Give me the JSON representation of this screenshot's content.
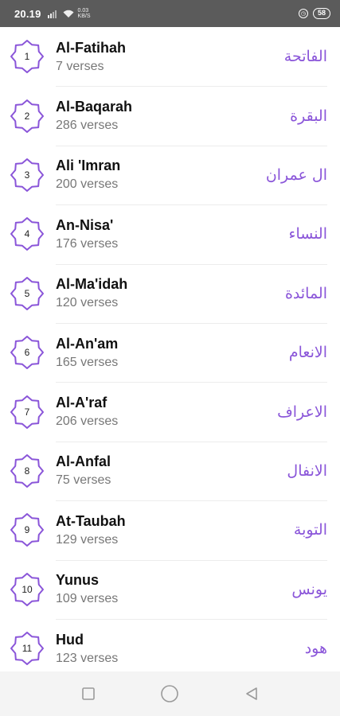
{
  "status_bar": {
    "time": "20.19",
    "network_speed": "0.03\nKB/S",
    "battery": "58"
  },
  "colors": {
    "accent": "#8a55d9",
    "status_bar": "#5b5b5b"
  },
  "surahs": [
    {
      "number": "1",
      "name": "Al-Fatihah",
      "verses": "7 verses",
      "arabic": "الفاتحة"
    },
    {
      "number": "2",
      "name": "Al-Baqarah",
      "verses": "286 verses",
      "arabic": "البقرة"
    },
    {
      "number": "3",
      "name": "Ali 'Imran",
      "verses": "200 verses",
      "arabic": "ال عمران"
    },
    {
      "number": "4",
      "name": "An-Nisa'",
      "verses": "176 verses",
      "arabic": "النساء"
    },
    {
      "number": "5",
      "name": "Al-Ma'idah",
      "verses": "120 verses",
      "arabic": "المائدة"
    },
    {
      "number": "6",
      "name": "Al-An'am",
      "verses": "165 verses",
      "arabic": "الانعام"
    },
    {
      "number": "7",
      "name": "Al-A'raf",
      "verses": "206 verses",
      "arabic": "الاعراف"
    },
    {
      "number": "8",
      "name": "Al-Anfal",
      "verses": "75 verses",
      "arabic": "الانفال"
    },
    {
      "number": "9",
      "name": "At-Taubah",
      "verses": "129 verses",
      "arabic": "التوبة"
    },
    {
      "number": "10",
      "name": "Yunus",
      "verses": "109 verses",
      "arabic": "يونس"
    },
    {
      "number": "11",
      "name": "Hud",
      "verses": "123 verses",
      "arabic": "هود"
    }
  ],
  "nav_icons": [
    "recent-apps-icon",
    "home-icon",
    "back-icon"
  ]
}
